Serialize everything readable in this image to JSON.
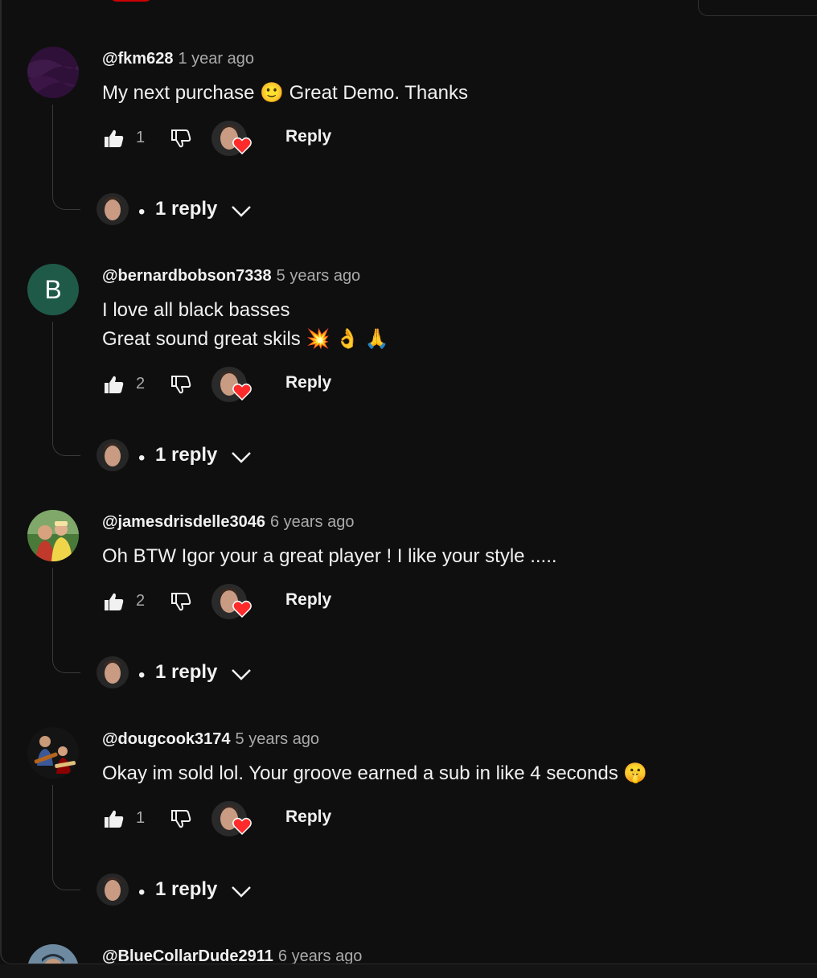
{
  "comments": [
    {
      "author": "@fkm628",
      "time": "1 year ago",
      "avatar": "purple-abstract",
      "text": "My next purchase 🙂 Great Demo. Thanks",
      "likes": "1",
      "reply_label": "Reply",
      "replies_label": "1 reply"
    },
    {
      "author": "@bernardbobson7338",
      "time": "5 years ago",
      "avatar_letter": "B",
      "text": "I love all black basses\nGreat sound great skils 💥 👌 🙏",
      "likes": "2",
      "reply_label": "Reply",
      "replies_label": "1 reply"
    },
    {
      "author": "@jamesdrisdelle3046",
      "time": "6 years ago",
      "avatar": "photo-two-people",
      "text": "Oh BTW Igor  your a great player ! I like your style .....",
      "likes": "2",
      "reply_label": "Reply",
      "replies_label": "1 reply"
    },
    {
      "author": "@dougcook3174",
      "time": "5 years ago",
      "avatar": "photo-guitar-players",
      "text": "Okay im sold lol. Your groove earned a sub in like 4 seconds 🤫",
      "likes": "1",
      "reply_label": "Reply",
      "replies_label": "1 reply"
    },
    {
      "author": "@BlueCollarDude2911",
      "time": "6 years ago",
      "avatar": "photo-person-cap"
    }
  ],
  "colors": {
    "background": "#0f0f0f",
    "text": "#f1f1f1",
    "secondary_text": "#aaaaaa",
    "heart": "#ff2b2b",
    "letter_avatar": "#1f5a48"
  },
  "icons": {
    "like": "thumbs-up-icon",
    "dislike": "thumbs-down-icon",
    "creator_heart": "heart-icon",
    "expand": "chevron-down-icon"
  }
}
